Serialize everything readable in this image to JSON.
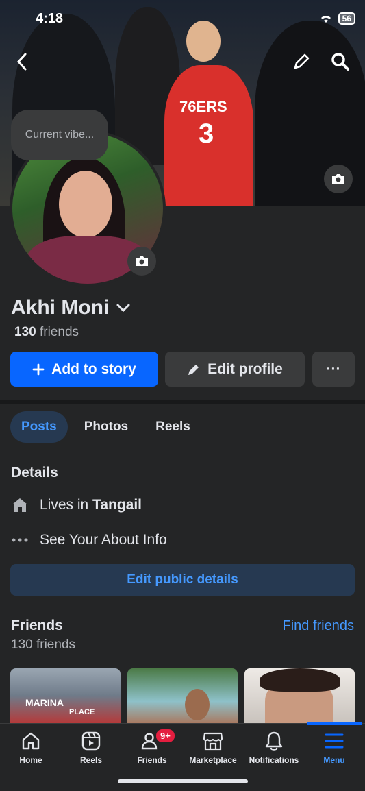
{
  "status": {
    "time": "4:18",
    "battery": "56"
  },
  "cover": {
    "vibe_prompt": "Current vibe...",
    "jersey_text": "76ERS",
    "jersey_number": "3"
  },
  "profile": {
    "name": "Akhi Moni",
    "friends_count": "130",
    "friends_label": "friends"
  },
  "actions": {
    "add_story": "Add to story",
    "edit_profile": "Edit profile",
    "more": "···"
  },
  "tabs": [
    {
      "label": "Posts",
      "active": true
    },
    {
      "label": "Photos",
      "active": false
    },
    {
      "label": "Reels",
      "active": false
    }
  ],
  "details": {
    "title": "Details",
    "lives_prefix": "Lives in",
    "lives_city": "Tangail",
    "about": "See Your About Info",
    "edit_button": "Edit public details"
  },
  "friends": {
    "title": "Friends",
    "find_link": "Find friends",
    "count_text": "130 friends",
    "thumb_caption_1": "MARINA",
    "thumb_caption_2": "PLACE"
  },
  "bottom_nav": {
    "items": [
      {
        "label": "Home",
        "icon": "home-icon"
      },
      {
        "label": "Reels",
        "icon": "reels-icon"
      },
      {
        "label": "Friends",
        "icon": "friends-icon",
        "badge": "9+"
      },
      {
        "label": "Marketplace",
        "icon": "marketplace-icon"
      },
      {
        "label": "Notifications",
        "icon": "bell-icon"
      },
      {
        "label": "Menu",
        "icon": "menu-icon",
        "active": true
      }
    ]
  },
  "colors": {
    "background": "#242526",
    "accent": "#0866ff",
    "link": "#4599ff",
    "badge": "#e41e3f"
  }
}
